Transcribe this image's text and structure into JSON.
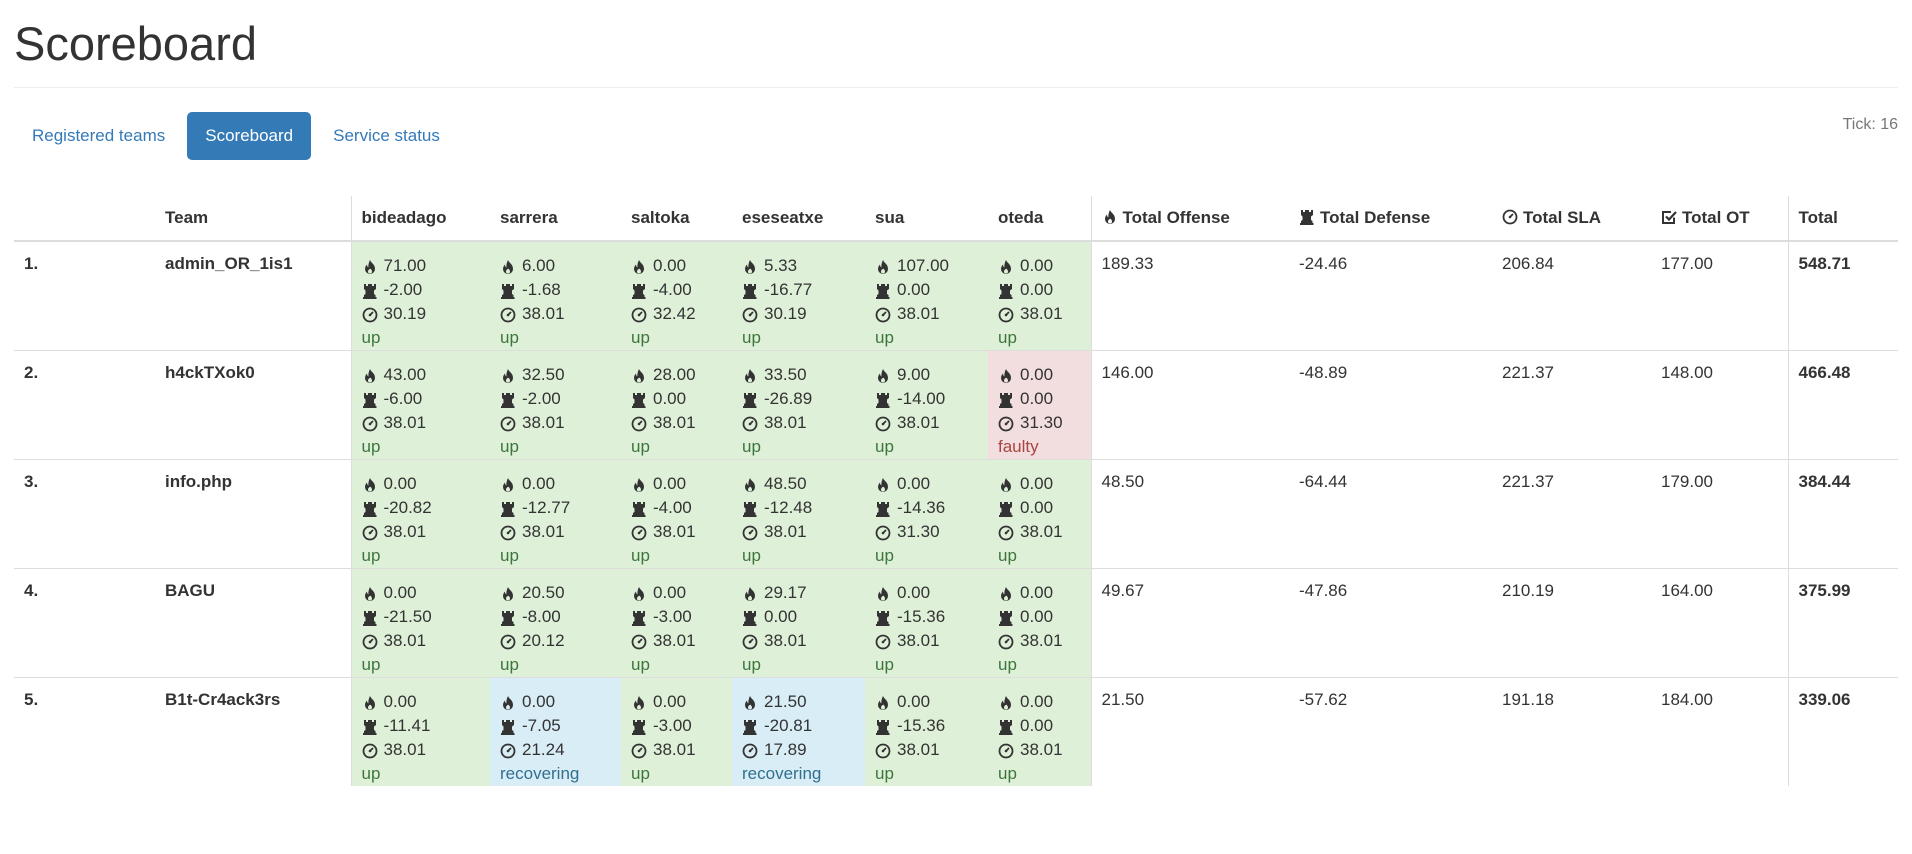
{
  "page": {
    "title": "Scoreboard",
    "tick": "Tick: 16"
  },
  "tabs": [
    {
      "label": "Registered teams",
      "active": false
    },
    {
      "label": "Scoreboard",
      "active": true
    },
    {
      "label": "Service status",
      "active": false
    }
  ],
  "colors": {
    "accent": "#337ab7",
    "up_bg": "#dff0d8",
    "up_text": "#3c763d",
    "faulty_bg": "#f2dede",
    "faulty_text": "#a94442",
    "recovering_bg": "#d9edf7",
    "recovering_text": "#31708f"
  },
  "icons": {
    "offense": "fire-icon",
    "defense": "rook-icon",
    "sla": "gauge-icon",
    "ot": "check-square-icon"
  },
  "headers": {
    "rank": "",
    "team": "Team",
    "services": [
      "bideadago",
      "sarrera",
      "saltoka",
      "eseseatxe",
      "sua",
      "oteda"
    ],
    "total_offense": "Total Offense",
    "total_defense": "Total Defense",
    "total_sla": "Total SLA",
    "total_ot": "Total OT",
    "total": "Total"
  },
  "rows": [
    {
      "rank": "1.",
      "team": "admin_OR_1is1",
      "services": [
        {
          "off": "71.00",
          "def": "-2.00",
          "sla": "30.19",
          "status": "up"
        },
        {
          "off": "6.00",
          "def": "-1.68",
          "sla": "38.01",
          "status": "up"
        },
        {
          "off": "0.00",
          "def": "-4.00",
          "sla": "32.42",
          "status": "up"
        },
        {
          "off": "5.33",
          "def": "-16.77",
          "sla": "30.19",
          "status": "up"
        },
        {
          "off": "107.00",
          "def": "0.00",
          "sla": "38.01",
          "status": "up"
        },
        {
          "off": "0.00",
          "def": "0.00",
          "sla": "38.01",
          "status": "up"
        }
      ],
      "total_offense": "189.33",
      "total_defense": "-24.46",
      "total_sla": "206.84",
      "total_ot": "177.00",
      "total": "548.71"
    },
    {
      "rank": "2.",
      "team": "h4ckTXok0",
      "services": [
        {
          "off": "43.00",
          "def": "-6.00",
          "sla": "38.01",
          "status": "up"
        },
        {
          "off": "32.50",
          "def": "-2.00",
          "sla": "38.01",
          "status": "up"
        },
        {
          "off": "28.00",
          "def": "0.00",
          "sla": "38.01",
          "status": "up"
        },
        {
          "off": "33.50",
          "def": "-26.89",
          "sla": "38.01",
          "status": "up"
        },
        {
          "off": "9.00",
          "def": "-14.00",
          "sla": "38.01",
          "status": "up"
        },
        {
          "off": "0.00",
          "def": "0.00",
          "sla": "31.30",
          "status": "faulty"
        }
      ],
      "total_offense": "146.00",
      "total_defense": "-48.89",
      "total_sla": "221.37",
      "total_ot": "148.00",
      "total": "466.48"
    },
    {
      "rank": "3.",
      "team": "info.php",
      "services": [
        {
          "off": "0.00",
          "def": "-20.82",
          "sla": "38.01",
          "status": "up"
        },
        {
          "off": "0.00",
          "def": "-12.77",
          "sla": "38.01",
          "status": "up"
        },
        {
          "off": "0.00",
          "def": "-4.00",
          "sla": "38.01",
          "status": "up"
        },
        {
          "off": "48.50",
          "def": "-12.48",
          "sla": "38.01",
          "status": "up"
        },
        {
          "off": "0.00",
          "def": "-14.36",
          "sla": "31.30",
          "status": "up"
        },
        {
          "off": "0.00",
          "def": "0.00",
          "sla": "38.01",
          "status": "up"
        }
      ],
      "total_offense": "48.50",
      "total_defense": "-64.44",
      "total_sla": "221.37",
      "total_ot": "179.00",
      "total": "384.44"
    },
    {
      "rank": "4.",
      "team": "BAGU",
      "services": [
        {
          "off": "0.00",
          "def": "-21.50",
          "sla": "38.01",
          "status": "up"
        },
        {
          "off": "20.50",
          "def": "-8.00",
          "sla": "20.12",
          "status": "up"
        },
        {
          "off": "0.00",
          "def": "-3.00",
          "sla": "38.01",
          "status": "up"
        },
        {
          "off": "29.17",
          "def": "0.00",
          "sla": "38.01",
          "status": "up"
        },
        {
          "off": "0.00",
          "def": "-15.36",
          "sla": "38.01",
          "status": "up"
        },
        {
          "off": "0.00",
          "def": "0.00",
          "sla": "38.01",
          "status": "up"
        }
      ],
      "total_offense": "49.67",
      "total_defense": "-47.86",
      "total_sla": "210.19",
      "total_ot": "164.00",
      "total": "375.99"
    },
    {
      "rank": "5.",
      "team": "B1t-Cr4ack3rs",
      "services": [
        {
          "off": "0.00",
          "def": "-11.41",
          "sla": "38.01",
          "status": "up"
        },
        {
          "off": "0.00",
          "def": "-7.05",
          "sla": "21.24",
          "status": "recovering"
        },
        {
          "off": "0.00",
          "def": "-3.00",
          "sla": "38.01",
          "status": "up"
        },
        {
          "off": "21.50",
          "def": "-20.81",
          "sla": "17.89",
          "status": "recovering"
        },
        {
          "off": "0.00",
          "def": "-15.36",
          "sla": "38.01",
          "status": "up"
        },
        {
          "off": "0.00",
          "def": "0.00",
          "sla": "38.01",
          "status": "up"
        }
      ],
      "total_offense": "21.50",
      "total_defense": "-57.62",
      "total_sla": "191.18",
      "total_ot": "184.00",
      "total": "339.06"
    }
  ]
}
